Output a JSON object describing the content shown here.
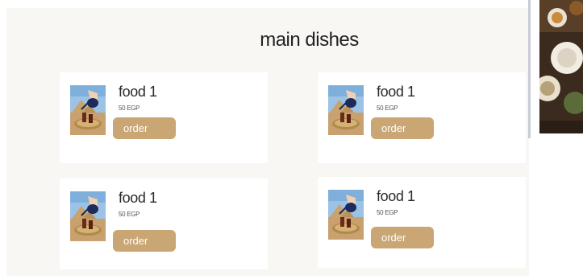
{
  "section": {
    "title": "main dishes"
  },
  "cards": [
    {
      "name": "food 1",
      "price": "50 EGP",
      "order_label": "order"
    },
    {
      "name": "food 1",
      "price": "50 EGP",
      "order_label": "order"
    },
    {
      "name": "food 1",
      "price": "50 EGP",
      "order_label": "order"
    },
    {
      "name": "food 1",
      "price": "50 EGP",
      "order_label": "order"
    }
  ],
  "colors": {
    "panel_background": "#f9f7f4",
    "card_background": "#ffffff",
    "order_button": "#c9a673",
    "order_text": "#ffffff"
  }
}
